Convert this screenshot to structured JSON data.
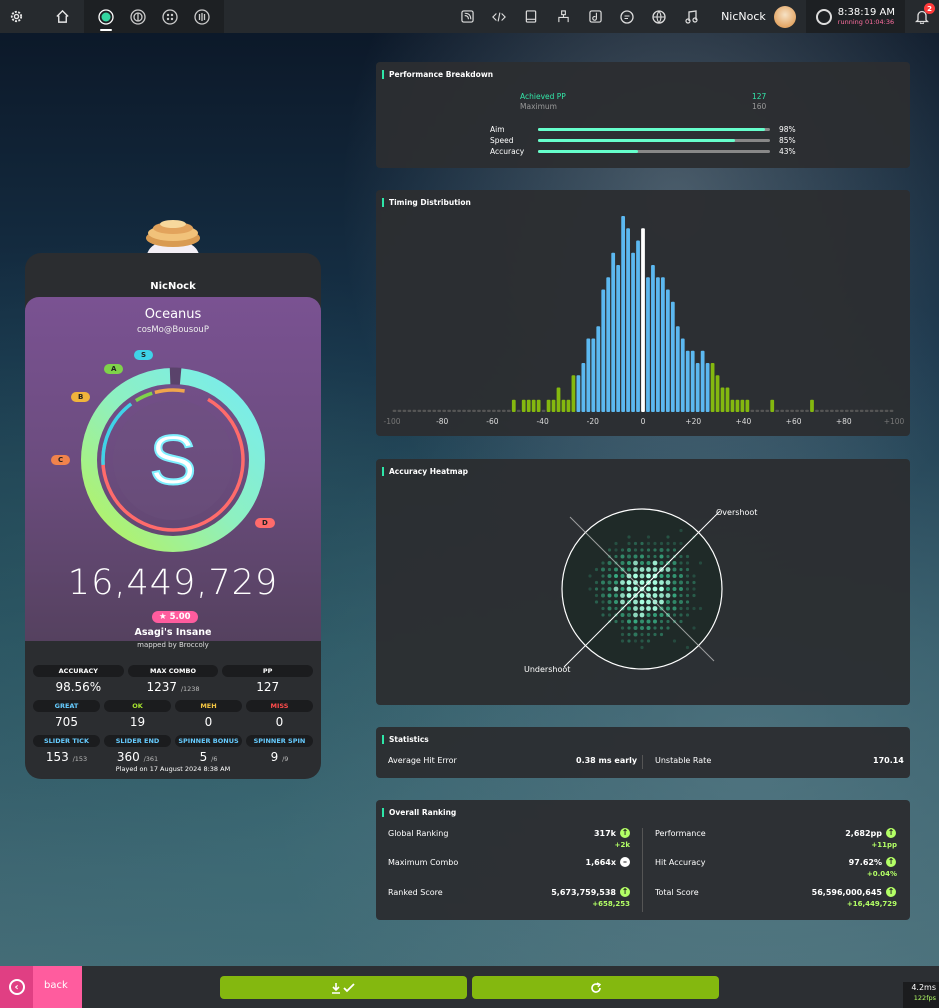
{
  "toolbar": {
    "left_icons": [
      "settings-icon",
      "home-icon"
    ],
    "ruleset_icons": [
      "osu-ruleset-icon",
      "taiko-ruleset-icon",
      "catch-ruleset-icon",
      "mania-ruleset-icon"
    ],
    "right_icons": [
      "news-icon",
      "code-icon",
      "wiki-icon",
      "rankings-icon",
      "beatmap-listing-icon",
      "chat-icon",
      "dashboard-icon",
      "music-icon"
    ],
    "username": "NicNock",
    "clock_time": "8:38:19 AM",
    "clock_running": "running 01:04:36",
    "notification_count": "2"
  },
  "score_panel": {
    "username": "NicNock",
    "title": "Oceanus",
    "artist": "cosMo@BousouP",
    "rank": "S",
    "grade_chips": [
      {
        "label": "S",
        "color": "#3fd3e8"
      },
      {
        "label": "A",
        "color": "#7fd34a"
      },
      {
        "label": "B",
        "color": "#f0b43c"
      },
      {
        "label": "C",
        "color": "#f0834c"
      },
      {
        "label": "D",
        "color": "#ff6b6b"
      }
    ],
    "accuracy_fraction": 0.9856,
    "total_score": "16,449,729",
    "star_rating": "★ 5.00",
    "difficulty": "Asagi's Insane",
    "mapper": "mapped by Broccoly",
    "played_at": "Played on 17 August 2024 8:38 AM",
    "stats_row1": [
      {
        "label": "ACCURACY",
        "value": "98.56%",
        "max": "",
        "label_color": "#ffffff"
      },
      {
        "label": "MAX COMBO",
        "value": "1237",
        "max": "/1238",
        "label_color": "#ffffff"
      },
      {
        "label": "PP",
        "value": "127",
        "max": "",
        "label_color": "#ffffff"
      }
    ],
    "stats_row2": [
      {
        "label": "GREAT",
        "value": "705",
        "label_color": "#66ccff"
      },
      {
        "label": "OK",
        "value": "19",
        "label_color": "#a6e22e"
      },
      {
        "label": "MEH",
        "value": "0",
        "label_color": "#f4c542"
      },
      {
        "label": "MISS",
        "value": "0",
        "label_color": "#ff4b4b"
      }
    ],
    "stats_row3": [
      {
        "label": "SLIDER TICK",
        "value": "153",
        "max": "/153",
        "label_color": "#66ccff"
      },
      {
        "label": "SLIDER END",
        "value": "360",
        "max": "/361",
        "label_color": "#66ccff"
      },
      {
        "label": "SPINNER BONUS",
        "value": "5",
        "max": "/6",
        "label_color": "#66ccff"
      },
      {
        "label": "SPINNER SPIN",
        "value": "9",
        "max": "/9",
        "label_color": "#66ccff"
      }
    ]
  },
  "performance": {
    "title": "Performance Breakdown",
    "achieved_label": "Achieved PP",
    "achieved_value": "127",
    "maximum_label": "Maximum",
    "maximum_value": "160",
    "bars": [
      {
        "label": "Aim",
        "percent_text": "98%",
        "fraction": 0.98
      },
      {
        "label": "Speed",
        "percent_text": "85%",
        "fraction": 0.85
      },
      {
        "label": "Accuracy",
        "percent_text": "43%",
        "fraction": 0.43
      }
    ]
  },
  "timing": {
    "title": "Timing Distribution",
    "tick_labels": [
      "-100",
      "-80",
      "-60",
      "-40",
      "-20",
      "0",
      "+20",
      "+40",
      "+60",
      "+80",
      "+100"
    ]
  },
  "chart_data": {
    "type": "bar",
    "title": "Timing Distribution",
    "x_range": [
      -100,
      100
    ],
    "bin_width": 2,
    "x": [
      -100,
      -98,
      -96,
      -94,
      -92,
      -90,
      -88,
      -86,
      -84,
      -82,
      -80,
      -78,
      -76,
      -74,
      -72,
      -70,
      -68,
      -66,
      -64,
      -62,
      -60,
      -58,
      -56,
      -54,
      -52,
      -50,
      -48,
      -46,
      -44,
      -42,
      -40,
      -38,
      -36,
      -34,
      -32,
      -30,
      -28,
      -26,
      -24,
      -22,
      -20,
      -18,
      -16,
      -14,
      -12,
      -10,
      -8,
      -6,
      -4,
      -2,
      0,
      2,
      4,
      6,
      8,
      10,
      12,
      14,
      16,
      18,
      20,
      22,
      24,
      26,
      28,
      30,
      32,
      34,
      36,
      38,
      40,
      42,
      44,
      46,
      48,
      50,
      52,
      54,
      56,
      58,
      60,
      62,
      64,
      66,
      68,
      70,
      72,
      74,
      76,
      78,
      80,
      82,
      84,
      86,
      88,
      90,
      92,
      94,
      96,
      98,
      100
    ],
    "values": [
      0,
      0,
      0,
      0,
      0,
      0,
      0,
      0,
      0,
      0,
      0,
      0,
      0,
      0,
      0,
      0,
      0,
      0,
      0,
      0,
      0,
      0,
      0,
      0,
      1,
      0,
      1,
      1,
      1,
      1,
      0,
      1,
      1,
      2,
      1,
      1,
      3,
      3,
      4,
      6,
      6,
      7,
      10,
      11,
      13,
      12,
      16,
      15,
      13,
      14,
      15,
      11,
      12,
      11,
      11,
      10,
      9,
      7,
      6,
      5,
      5,
      4,
      5,
      4,
      4,
      3,
      2,
      2,
      1,
      1,
      1,
      1,
      0,
      0,
      0,
      0,
      1,
      0,
      0,
      0,
      0,
      0,
      0,
      0,
      1,
      0,
      0,
      0,
      0,
      0,
      0,
      0,
      0,
      0,
      0,
      0,
      0,
      0,
      0,
      0,
      0
    ],
    "zero_marker": 0,
    "colors": {
      "hit": "#5cb8f0",
      "zero": "#ffffff",
      "outer": "#84b80f",
      "empty": "#555555"
    }
  },
  "heatmap": {
    "title": "Accuracy Heatmap",
    "overshoot_label": "Overshoot",
    "undershoot_label": "Undershoot"
  },
  "statistics": {
    "title": "Statistics",
    "avg_label": "Average Hit Error",
    "avg_value": "0.38 ms early",
    "ur_label": "Unstable Rate",
    "ur_value": "170.14"
  },
  "ranking": {
    "title": "Overall Ranking",
    "rows": [
      {
        "label": "Global Ranking",
        "value": "317k",
        "delta": "+2k",
        "trend": "up"
      },
      {
        "label": "Performance",
        "value": "2,682pp",
        "delta": "+11pp",
        "trend": "up"
      },
      {
        "label": "Maximum Combo",
        "value": "1,664x",
        "delta": "",
        "trend": "none"
      },
      {
        "label": "Hit Accuracy",
        "value": "97.62%",
        "delta": "+0.04%",
        "trend": "up"
      },
      {
        "label": "Ranked Score",
        "value": "5,673,759,538",
        "delta": "+658,253",
        "trend": "up"
      },
      {
        "label": "Total Score",
        "value": "56,596,000,645",
        "delta": "+16,449,729",
        "trend": "up"
      }
    ]
  },
  "footer": {
    "back_label": "back",
    "download_icon": "download-check-icon",
    "retry_icon": "retry-icon",
    "frame_time": "4.2ms",
    "fps": "122fps",
    "accent": "#84b80f"
  }
}
